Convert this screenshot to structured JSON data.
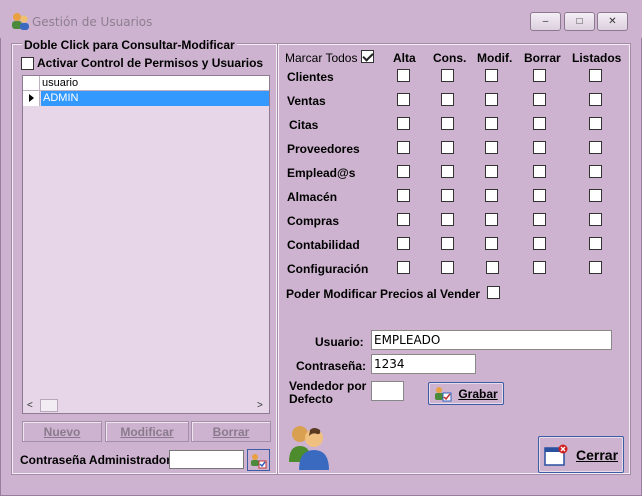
{
  "window": {
    "title": "Gestión de Usuarios",
    "controls": {
      "minimize": "–",
      "maximize": "□",
      "close": "✕"
    }
  },
  "left": {
    "group_title": "Doble Click para Consultar-Modificar",
    "activar_label": "Activar Control de Permisos y Usuarios",
    "activar_checked": false,
    "grid": {
      "column": "usuario",
      "rows": [
        "ADMIN"
      ]
    },
    "scroll_left": "<",
    "scroll_right": ">",
    "buttons": {
      "nuevo": "Nuevo",
      "modificar": "Modificar",
      "borrar": "Borrar"
    },
    "admin_password_label": "Contraseña Administrador:",
    "admin_password_value": ""
  },
  "right": {
    "marcar_todos": "Marcar Todos",
    "marcar_todos_checked": true,
    "columns": [
      "Alta",
      "Cons.",
      "Modif.",
      "Borrar",
      "Listados"
    ],
    "modules": [
      "Clientes",
      "Ventas",
      "Citas",
      "Proveedores",
      "Emplead@s",
      "Almacén",
      "Compras",
      "Contabilidad",
      "Configuración"
    ],
    "poder_modificar": "Poder Modificar Precios al Vender",
    "usuario_label": "Usuario:",
    "usuario_value": "EMPLEADO",
    "password_label": "Contraseña:",
    "password_value": "1234",
    "vendedor_label_1": "Vendedor por",
    "vendedor_label_2": "Defecto",
    "vendedor_value": "",
    "grabar": "Grabar",
    "cerrar": "Cerrar"
  },
  "colors": {
    "background": "#cdb3cf",
    "selection": "#3399ff",
    "button_border": "#3a5da5"
  }
}
